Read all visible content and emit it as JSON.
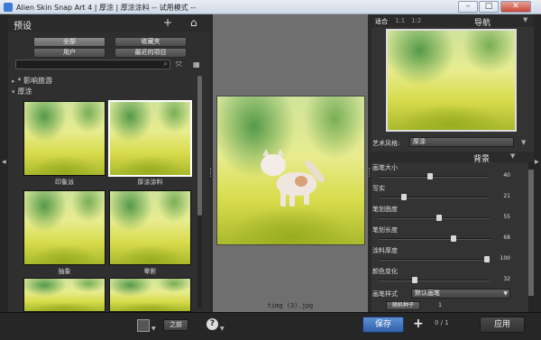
{
  "window": {
    "title": "Alien Skin Snap Art 4 | 厚涂 | 厚涂涂料 -- 试用模式 --",
    "minimize": "–",
    "maximize": "□",
    "close": "✕"
  },
  "presets": {
    "title": "预设",
    "add_icon": "+",
    "home_icon": "⌂",
    "filters": [
      "全部",
      "收藏夹",
      "用户",
      "最近的项目"
    ],
    "search_placeholder": "",
    "tree": [
      {
        "label": "* 影响旅游",
        "arrow": "▸"
      },
      {
        "label": "厚涂",
        "arrow": "▾"
      }
    ],
    "thumbnails": [
      {
        "label": "印象派"
      },
      {
        "label": "厚涂涂料"
      },
      {
        "label": "抽象"
      },
      {
        "label": "晕影"
      },
      {
        "label": ""
      },
      {
        "label": ""
      }
    ]
  },
  "center": {
    "filename": "timg (3).jpg"
  },
  "navigator": {
    "zoom_fit": "适合",
    "zoom_1_1": "1:1",
    "zoom_1_2": "1:2",
    "title": "导航",
    "collapse": "▼"
  },
  "art_style": {
    "label": "艺术风格:",
    "value": "厚涂"
  },
  "background": {
    "title": "背景",
    "collapse": "▼",
    "params": [
      {
        "label": "画笔大小",
        "value": "40",
        "fraction": 0.46
      },
      {
        "label": "写实",
        "value": "21",
        "fraction": 0.21
      },
      {
        "label": "笔划曲度",
        "value": "55",
        "fraction": 0.55
      },
      {
        "label": "笔划长度",
        "value": "68",
        "fraction": 0.68
      },
      {
        "label": "涂料厚度",
        "value": "100",
        "fraction": 1.0
      },
      {
        "label": "颜色变化",
        "value": "32",
        "fraction": 0.32
      }
    ],
    "brush_style_label": "画笔样式",
    "brush_style_value": "默认画笔",
    "seed_button": "随机种子",
    "seed_value": "1"
  },
  "bottom": {
    "before_label": "之前",
    "help": "?",
    "save": "保存",
    "add": "+",
    "page": "0 / 1",
    "apply": "应用"
  }
}
